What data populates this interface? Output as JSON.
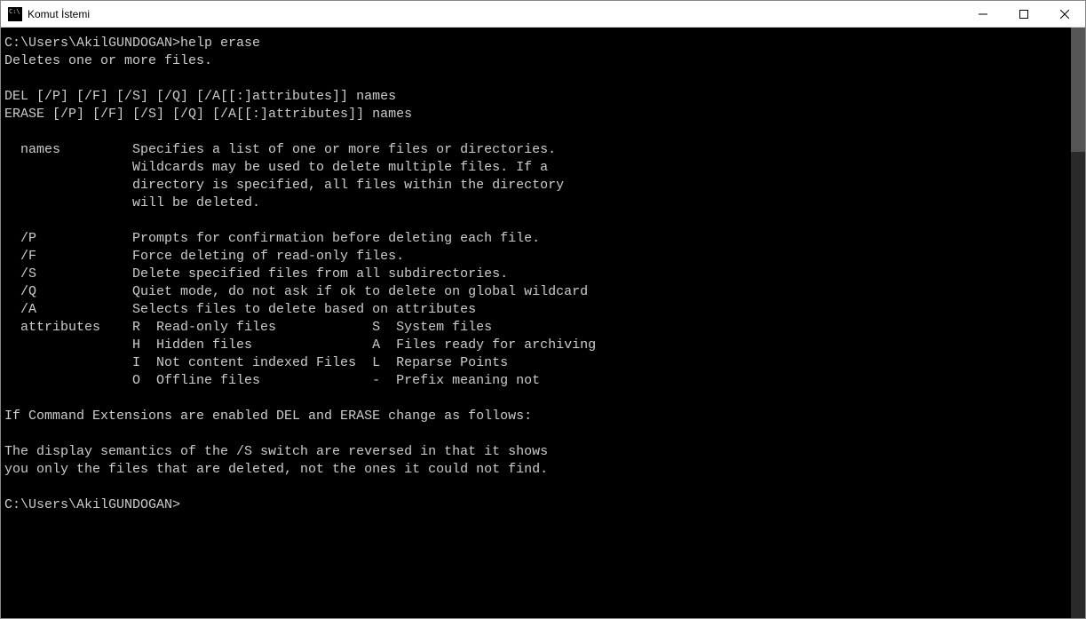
{
  "window": {
    "title": "Komut İstemi"
  },
  "terminal": {
    "prompt1": "C:\\Users\\AkilGUNDOGAN>",
    "command1": "help erase",
    "lines": [
      "Deletes one or more files.",
      "",
      "DEL [/P] [/F] [/S] [/Q] [/A[[:]attributes]] names",
      "ERASE [/P] [/F] [/S] [/Q] [/A[[:]attributes]] names",
      "",
      "  names         Specifies a list of one or more files or directories.",
      "                Wildcards may be used to delete multiple files. If a",
      "                directory is specified, all files within the directory",
      "                will be deleted.",
      "",
      "  /P            Prompts for confirmation before deleting each file.",
      "  /F            Force deleting of read-only files.",
      "  /S            Delete specified files from all subdirectories.",
      "  /Q            Quiet mode, do not ask if ok to delete on global wildcard",
      "  /A            Selects files to delete based on attributes",
      "  attributes    R  Read-only files            S  System files",
      "                H  Hidden files               A  Files ready for archiving",
      "                I  Not content indexed Files  L  Reparse Points",
      "                O  Offline files              -  Prefix meaning not",
      "",
      "If Command Extensions are enabled DEL and ERASE change as follows:",
      "",
      "The display semantics of the /S switch are reversed in that it shows",
      "you only the files that are deleted, not the ones it could not find.",
      ""
    ],
    "prompt2": "C:\\Users\\AkilGUNDOGAN>"
  }
}
